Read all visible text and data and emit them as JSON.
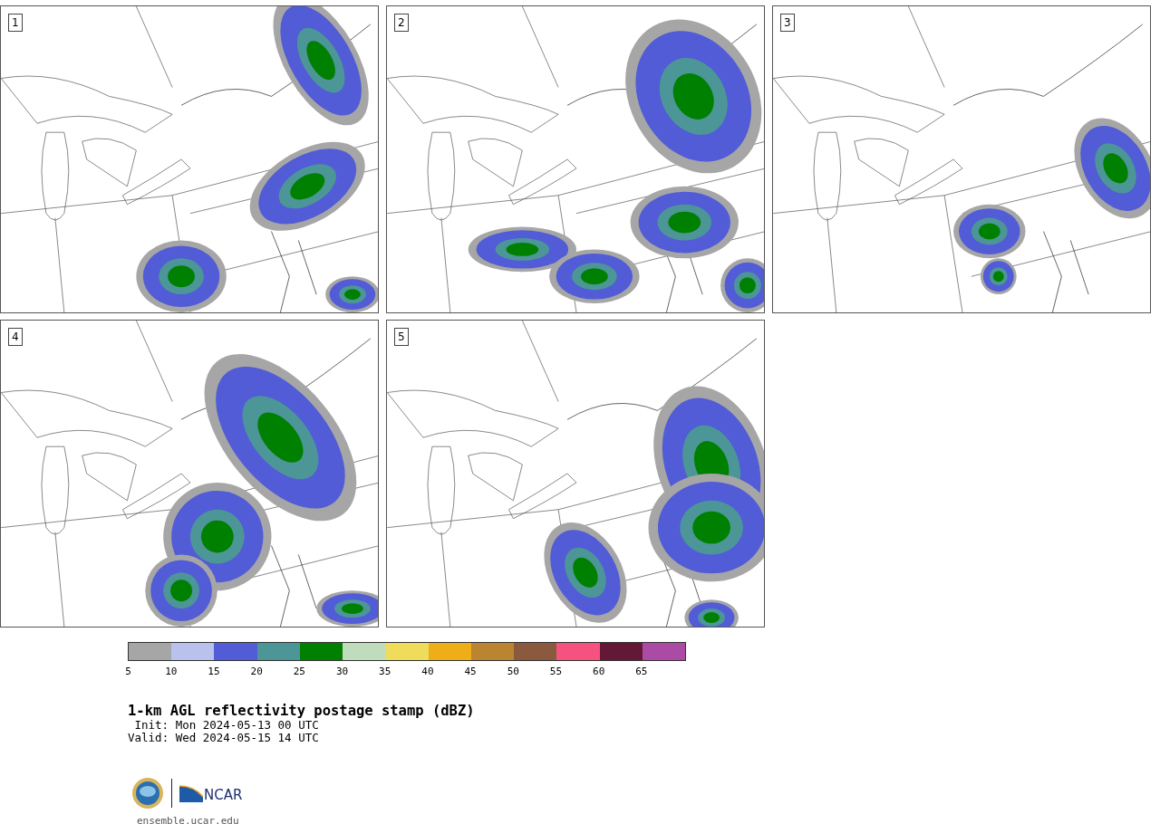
{
  "panels": [
    {
      "label": "1"
    },
    {
      "label": "2"
    },
    {
      "label": "3"
    },
    {
      "label": "4"
    },
    {
      "label": "5"
    }
  ],
  "colorbar": {
    "bins": [
      {
        "color": "#a6a6a6"
      },
      {
        "color": "#b8c2ec"
      },
      {
        "color": "#515cd6"
      },
      {
        "color": "#4d9698"
      },
      {
        "color": "#008000"
      },
      {
        "color": "#bfdcbc"
      },
      {
        "color": "#eedc5a"
      },
      {
        "color": "#efae17"
      },
      {
        "color": "#ba8430"
      },
      {
        "color": "#8b5a3e"
      },
      {
        "color": "#f5527f"
      },
      {
        "color": "#631935"
      },
      {
        "color": "#ac4ba5"
      }
    ],
    "ticks": [
      "5",
      "10",
      "15",
      "20",
      "25",
      "30",
      "35",
      "40",
      "45",
      "50",
      "55",
      "60",
      "65"
    ]
  },
  "title": "1-km AGL reflectivity postage stamp (dBZ)",
  "init": "Init: Mon 2024-05-13 00 UTC",
  "valid": "Valid: Wed 2024-05-15 14 UTC",
  "logo": {
    "wordmark": "NCAR"
  },
  "footer": "ensemble.ucar.edu"
}
